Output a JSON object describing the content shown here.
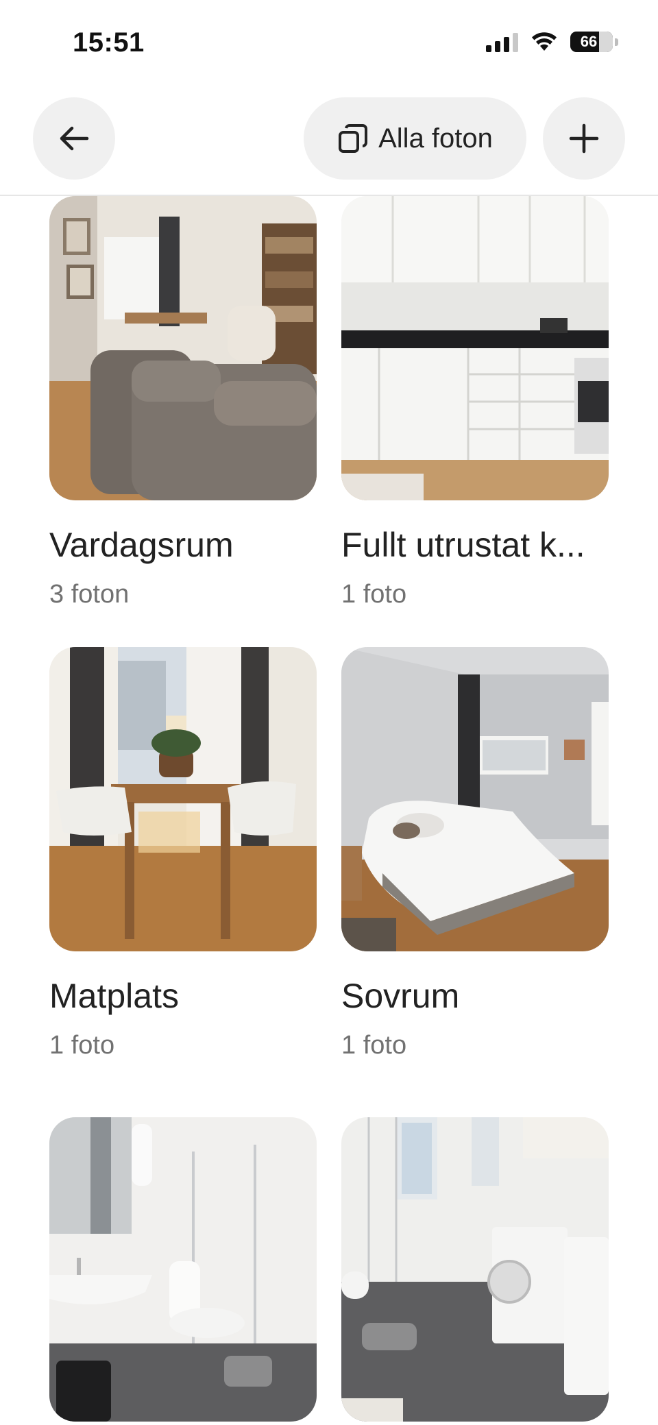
{
  "status_bar": {
    "time": "15:51",
    "battery": "66",
    "icons": [
      "cellular-signal-icon",
      "wifi-icon",
      "battery-icon"
    ]
  },
  "header": {
    "back_icon": "arrow-left-icon",
    "all_photos_label": "Alla foton",
    "all_photos_icon": "photo-stack-icon",
    "add_icon": "plus-icon"
  },
  "rooms": [
    {
      "title": "Vardagsrum",
      "count": "3 foton",
      "photo": "living-room"
    },
    {
      "title": "Fullt utrustat k...",
      "count": "1 foto",
      "photo": "kitchen"
    },
    {
      "title": "Matplats",
      "count": "1 foto",
      "photo": "dining-area"
    },
    {
      "title": "Sovrum",
      "count": "1 foto",
      "photo": "bedroom"
    },
    {
      "title": "",
      "count": "",
      "photo": "bathroom"
    },
    {
      "title": "",
      "count": "",
      "photo": "laundry-bathroom"
    }
  ],
  "colors": {
    "text_primary": "#222222",
    "text_secondary": "#717171",
    "button_bg": "#f0f0f0",
    "divider": "#e6e6e6"
  }
}
